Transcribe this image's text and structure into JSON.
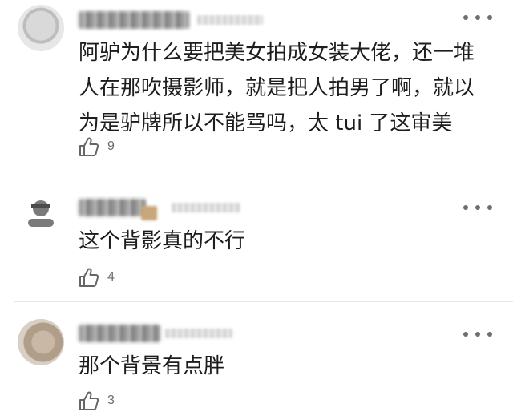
{
  "comments": [
    {
      "text": "阿驴为什么要把美女拍成女装大佬，还一堆\n人在那吹摄影师，就是把人拍男了啊，就以\n为是驴牌所以不能骂吗，太 tui 了这审美",
      "likes": "9",
      "avatar_icon": "user-avatar-icon"
    },
    {
      "text": "这个背影真的不行",
      "likes": "4",
      "avatar_icon": "user-avatar-icon"
    },
    {
      "text": "那个背景有点胖",
      "likes": "3",
      "avatar_icon": "user-avatar-icon"
    }
  ],
  "icons": {
    "more": "more-dots-icon",
    "like": "thumbs-up-icon"
  },
  "colors": {
    "text": "#1d1d1d",
    "meta": "#6b6b6b",
    "divider": "#e6e6e6"
  }
}
